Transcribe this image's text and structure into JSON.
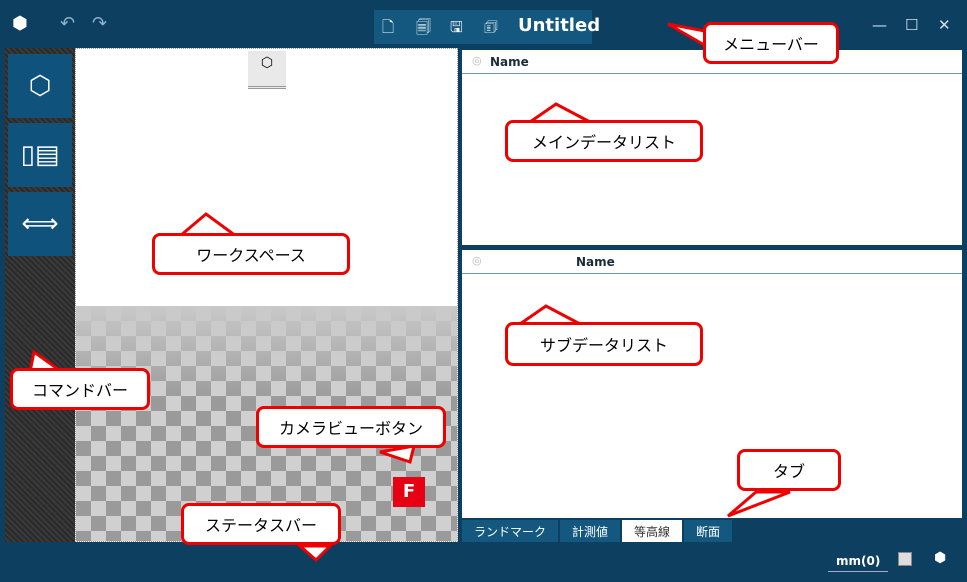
{
  "titlebar": {
    "title": "Untitled",
    "icons": [
      "app-logo",
      "undo-icon",
      "redo-icon",
      "new-file-icon",
      "open-file-icon",
      "save-icon",
      "save-as-icon"
    ],
    "window_controls": [
      "minimize",
      "maximize",
      "close"
    ]
  },
  "command_bar": {
    "buttons": [
      "3d-model-icon",
      "measure-ruler-icon",
      "arrows-horizontal-icon"
    ]
  },
  "workspace": {
    "camera_button": "F"
  },
  "main_list": {
    "column": "Name"
  },
  "sub_list": {
    "column": "Name"
  },
  "tabs": [
    {
      "label": "ランドマーク"
    },
    {
      "label": "計測値"
    },
    {
      "label": "等高線",
      "active": true
    },
    {
      "label": "断面"
    }
  ],
  "status": {
    "unit": "mm(0)"
  },
  "callouts": {
    "menubar": "メニューバー",
    "main_list": "メインデータリスト",
    "workspace": "ワークスペース",
    "sub_list": "サブデータリスト",
    "command_bar": "コマンドバー",
    "camera": "カメラビューボタン",
    "tab": "タブ",
    "status_bar": "ステータスバー"
  },
  "colors": {
    "navy": "#0c3f60",
    "accent": "#14587f",
    "callout": "#e00000"
  }
}
